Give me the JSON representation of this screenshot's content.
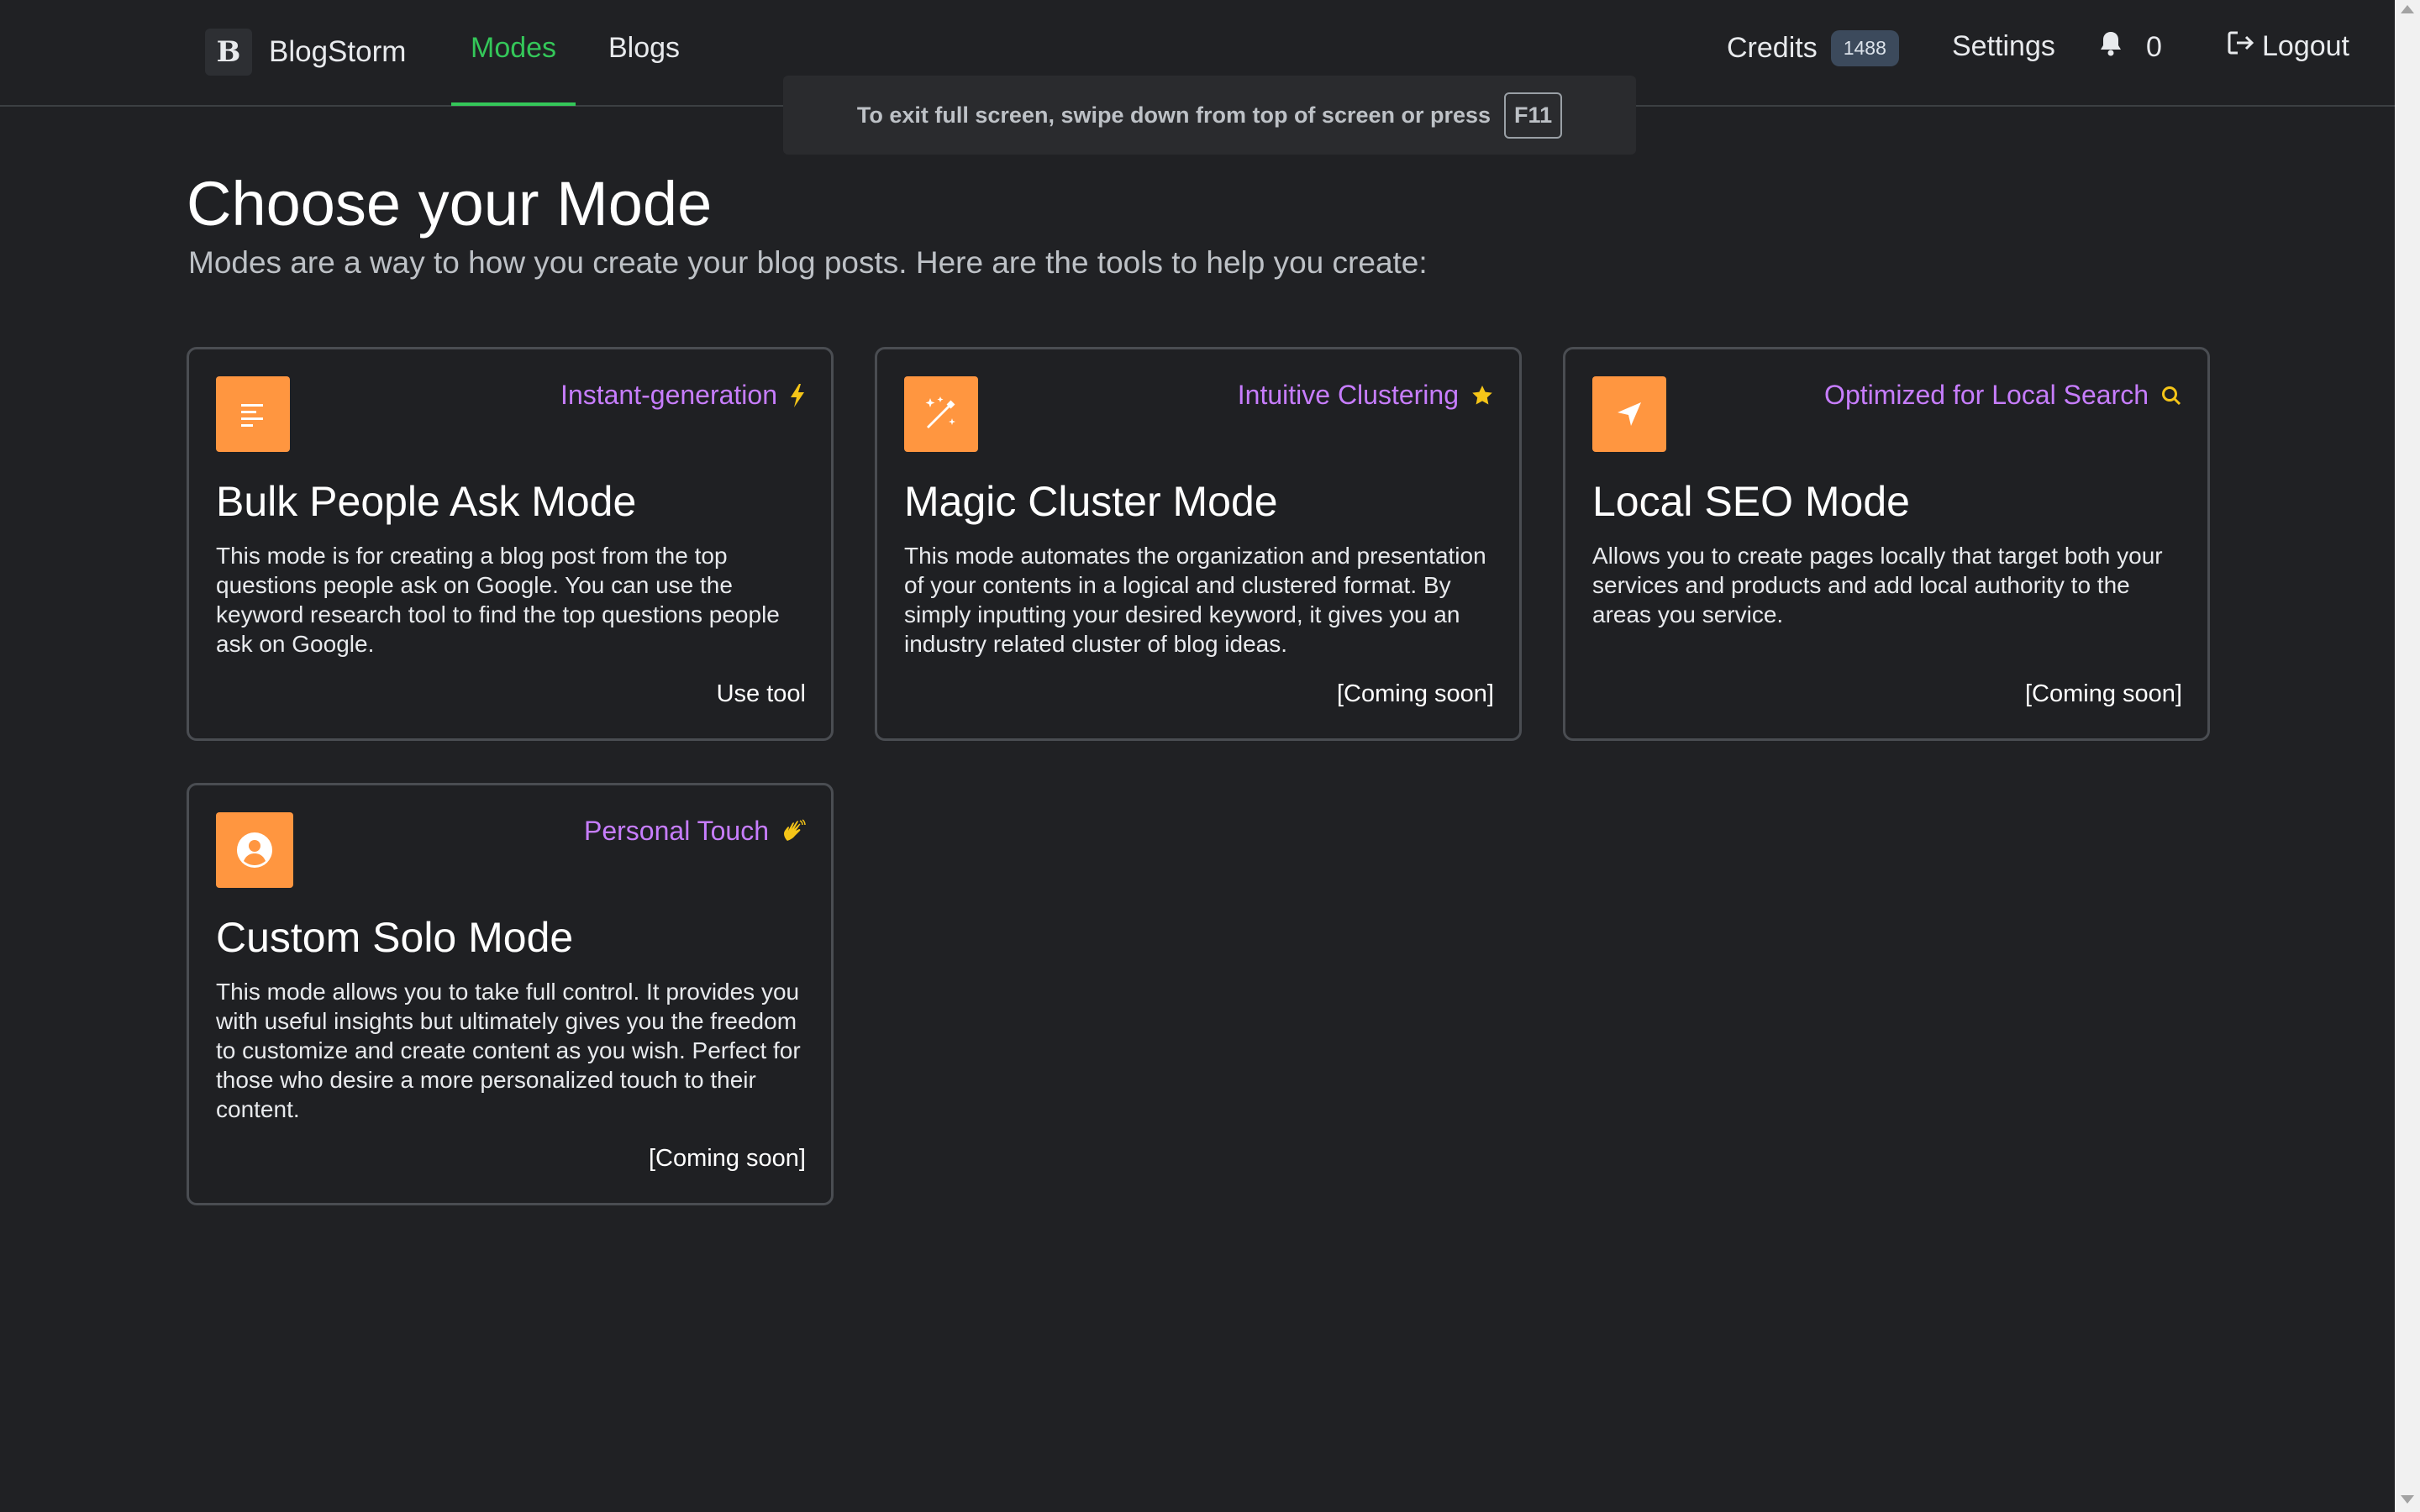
{
  "navbar": {
    "brand_logo": "B",
    "brand_name": "BlogStorm",
    "links": {
      "modes": "Modes",
      "blogs": "Blogs"
    },
    "credits_label": "Credits",
    "credits_value": "1488",
    "settings_label": "Settings",
    "notifications_count": "0",
    "logout_label": "Logout",
    "accent_color": "#34c759"
  },
  "fullscreen_toast": {
    "text": "To exit full screen, swipe down from top of screen or press",
    "key": "F11"
  },
  "page": {
    "title": "Choose your Mode",
    "subtitle": "Modes are a way to how you create your blog posts. Here are the tools to help you create:"
  },
  "cards": [
    {
      "tag": "Instant-generation",
      "tag_icon": "lightning-icon",
      "icon": "document-lines-icon",
      "title": "Bulk People Ask Mode",
      "description": "This mode is for creating a blog post from the top questions people ask on Google. You can use the keyword research tool to find the top questions people ask on Google.",
      "action": "Use tool"
    },
    {
      "tag": "Intuitive Clustering",
      "tag_icon": "star-icon",
      "icon": "magic-wand-icon",
      "title": "Magic Cluster Mode",
      "description": "This mode automates the organization and presentation of your contents in a logical and clustered format. By simply inputting your desired keyword, it gives you an industry related cluster of blog ideas.",
      "action": "[Coming soon]"
    },
    {
      "tag": "Optimized for Local Search",
      "tag_icon": "search-icon",
      "icon": "navigation-arrow-icon",
      "title": "Local SEO Mode",
      "description": "Allows you to create pages locally that target both your services and products and add local authority to the areas you service.",
      "action": "[Coming soon]"
    },
    {
      "tag": "Personal Touch",
      "tag_icon": "waving-hand-icon",
      "icon": "user-circle-icon",
      "title": "Custom Solo Mode",
      "description": "This mode allows you to take full control. It provides you with useful insights but ultimately gives you the freedom to customize and create content as you wish. Perfect for those who desire a more personalized touch to their content.",
      "action": "[Coming soon]"
    }
  ],
  "colors": {
    "background": "#202124",
    "card_icon_bg": "#ff9640",
    "tag_text": "#c77dff",
    "tag_icon": "#f5c518"
  }
}
